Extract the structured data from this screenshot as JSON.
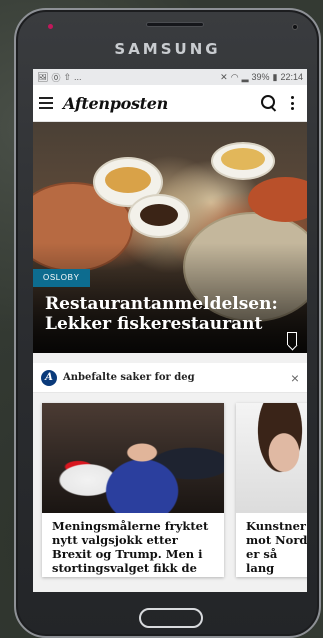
{
  "device": {
    "brand": "SAMSUNG"
  },
  "status_bar": {
    "left_icons": [
      "image-icon",
      "notification-icon",
      "upload-icon"
    ],
    "left_more": "...",
    "battery": "39%",
    "time": "22:14"
  },
  "app_bar": {
    "logo": "Aftenposten"
  },
  "hero": {
    "tag": "OSLOBY",
    "title": "Restaurantanmeldelsen: Lekker fiskerestaurant"
  },
  "recommended": {
    "logo_letter": "A",
    "title": "Anbefalte saker for deg",
    "close": "×",
    "cards": [
      {
        "headline": "Meningsmålerne fryktet nytt valgsjokk etter Brexit og Trump. Men i stortingsvalget fikk de n..."
      },
      {
        "headline": "Kunstner mot Nord er så lang virkeligh"
      }
    ]
  }
}
